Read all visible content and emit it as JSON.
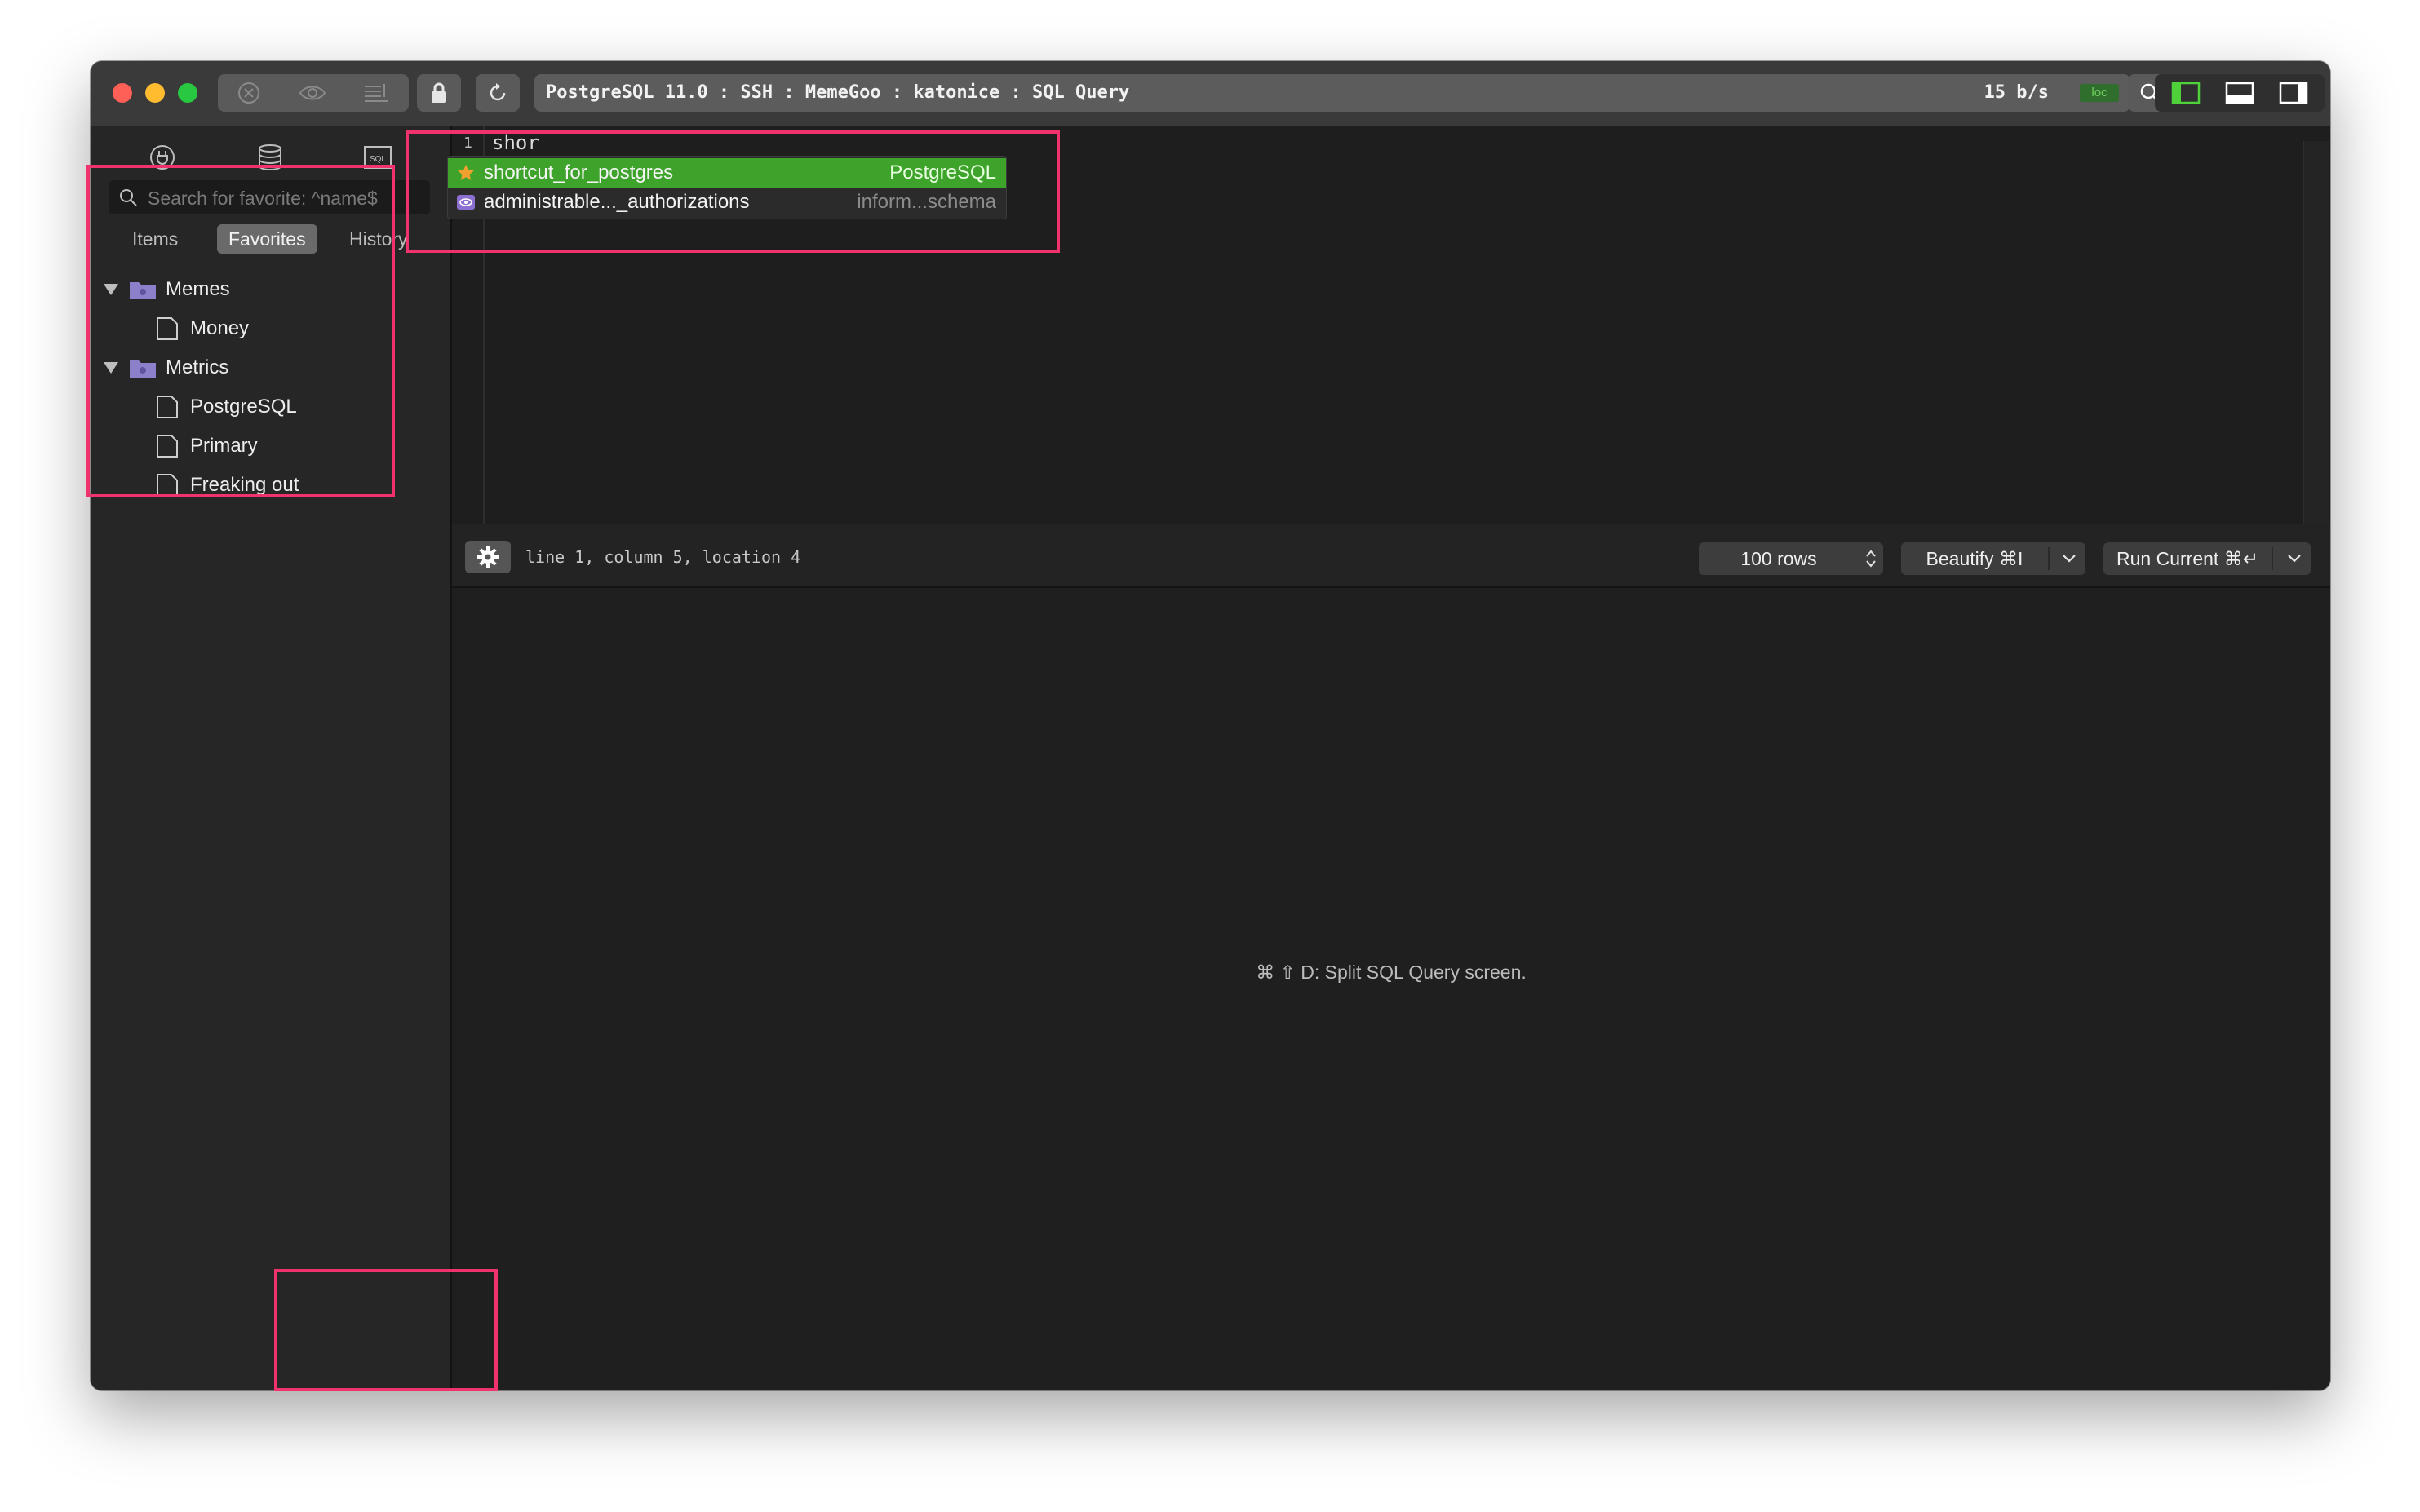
{
  "titlebar": {
    "address": "PostgreSQL 11.0 : SSH : MemeGoo : katonice : SQL Query",
    "speed": "15 b/s",
    "loc_badge": "loc"
  },
  "sidebar": {
    "search_placeholder": "Search for favorite: ^name$",
    "tabs": [
      {
        "label": "Items"
      },
      {
        "label": "Favorites"
      },
      {
        "label": "History"
      }
    ],
    "active_tab": "Favorites",
    "tree": [
      {
        "label": "Memes",
        "type": "folder"
      },
      {
        "label": "Money",
        "type": "file"
      },
      {
        "label": "Metrics",
        "type": "folder"
      },
      {
        "label": "PostgreSQL",
        "type": "file"
      },
      {
        "label": "Primary",
        "type": "file"
      },
      {
        "label": "Freaking out",
        "type": "file"
      }
    ]
  },
  "editor": {
    "line_number": "1",
    "code": "shor",
    "autocomplete": [
      {
        "name": "shortcut_for_postgres",
        "meta": "PostgreSQL",
        "icon": "star-icon",
        "selected": true
      },
      {
        "name": "administrable..._authorizations",
        "meta": "inform...schema",
        "icon": "view-icon",
        "selected": false
      }
    ]
  },
  "status": {
    "cursor": "line 1, column 5, location 4",
    "rows": "100 rows",
    "beautify": "Beautify ⌘I",
    "run": "Run Current ⌘↵"
  },
  "results": {
    "hint": "⌘ ⇧ D: Split SQL Query screen."
  },
  "colors": {
    "accent_green": "#3ea32b",
    "annotation": "#f0326d",
    "folder": "#8b80c9"
  }
}
